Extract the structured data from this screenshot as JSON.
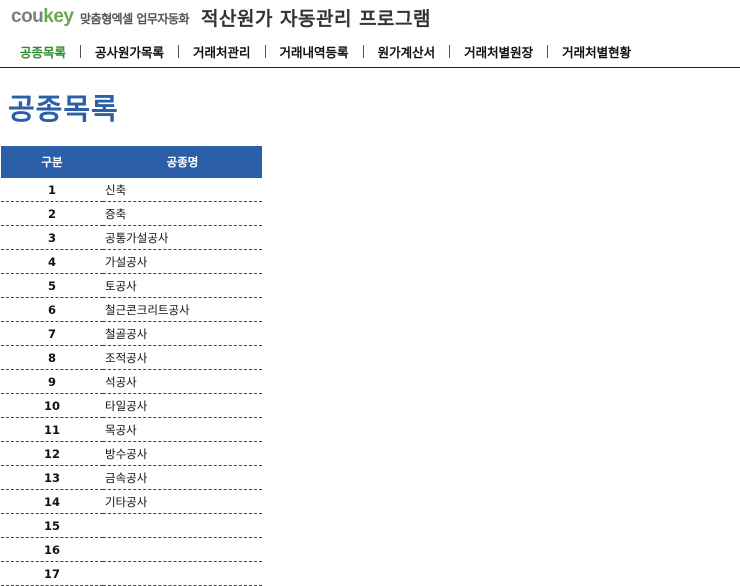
{
  "header": {
    "logo_part1": "cou",
    "logo_part2": "key",
    "tagline": "맞춤형엑셀 업무자동화",
    "app_title": "적산원가 자동관리 프로그램"
  },
  "nav": {
    "items": [
      "공종목록",
      "공사원가목록",
      "거래처관리",
      "거래내역등록",
      "원가계산서",
      "거래처별원장",
      "거래처별현황"
    ],
    "active": "공종목록"
  },
  "page_title": "공종목록",
  "table": {
    "headers": [
      "구분",
      "공종명"
    ],
    "rows": [
      {
        "no": "1",
        "name": "신축"
      },
      {
        "no": "2",
        "name": "증축"
      },
      {
        "no": "3",
        "name": "공통가설공사"
      },
      {
        "no": "4",
        "name": "가설공사"
      },
      {
        "no": "5",
        "name": "토공사"
      },
      {
        "no": "6",
        "name": "철근콘크리트공사"
      },
      {
        "no": "7",
        "name": "철골공사"
      },
      {
        "no": "8",
        "name": "조적공사"
      },
      {
        "no": "9",
        "name": "석공사"
      },
      {
        "no": "10",
        "name": "타일공사"
      },
      {
        "no": "11",
        "name": "목공사"
      },
      {
        "no": "12",
        "name": "방수공사"
      },
      {
        "no": "13",
        "name": "금속공사"
      },
      {
        "no": "14",
        "name": "기타공사"
      },
      {
        "no": "15",
        "name": ""
      },
      {
        "no": "16",
        "name": ""
      },
      {
        "no": "17",
        "name": ""
      }
    ]
  },
  "colors": {
    "accent_blue": "#2b5fa8",
    "active_nav_green": "#2e8b2e",
    "logo_green": "#6aa84f"
  }
}
